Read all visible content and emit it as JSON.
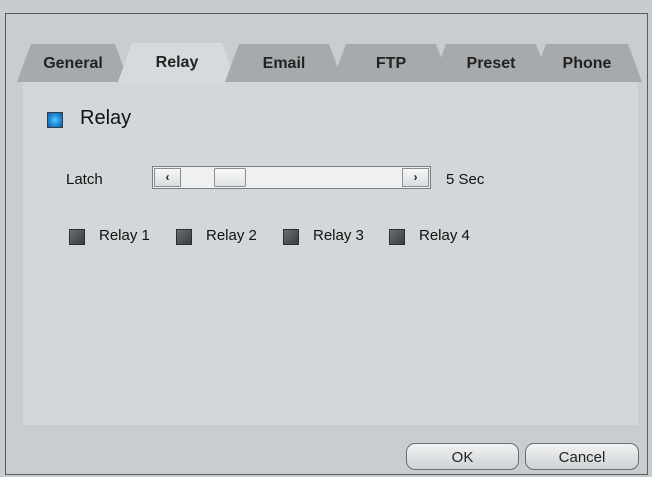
{
  "tabs": [
    {
      "label": "General",
      "active": false
    },
    {
      "label": "Relay",
      "active": true
    },
    {
      "label": "Email",
      "active": false
    },
    {
      "label": "FTP",
      "active": false
    },
    {
      "label": "Preset",
      "active": false
    },
    {
      "label": "Phone",
      "active": false
    }
  ],
  "relay_section": {
    "title": "Relay",
    "enabled": true,
    "latch_label": "Latch",
    "latch_value_text": "5 Sec",
    "scroll_left_glyph": "‹",
    "scroll_right_glyph": "›",
    "latch_level_fraction": 0.17
  },
  "relays": [
    {
      "label": "Relay 1",
      "checked": false
    },
    {
      "label": "Relay 2",
      "checked": false
    },
    {
      "label": "Relay 3",
      "checked": false
    },
    {
      "label": "Relay 4",
      "checked": false
    }
  ],
  "buttons": {
    "ok": "OK",
    "cancel": "Cancel"
  },
  "colors": {
    "accent": "#1d8bd8",
    "active_tab": "#d6dadc",
    "inactive_tab": "#a7aaac"
  }
}
